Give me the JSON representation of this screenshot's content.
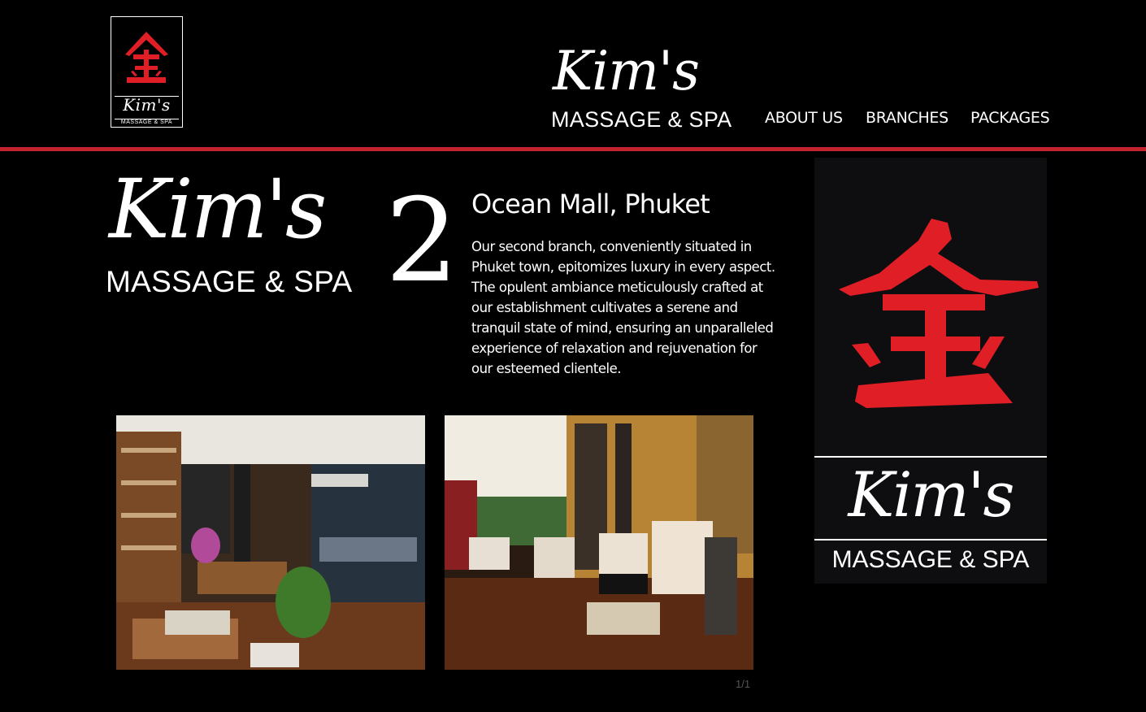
{
  "header": {
    "small_logo": {
      "brand": "Kim's",
      "subtitle": "MASSAGE & SPA",
      "glyph": "金"
    },
    "brand": {
      "name": "Kim's",
      "subtitle": "MASSAGE & SPA"
    },
    "nav": [
      {
        "label": "ABOUT US"
      },
      {
        "label": "BRANCHES"
      },
      {
        "label": "PACKAGES"
      }
    ]
  },
  "branch": {
    "logo": {
      "name": "Kim's",
      "subtitle": "MASSAGE & SPA",
      "number": "2"
    },
    "title": "Ocean Mall, Phuket",
    "description": "Our second branch, conveniently situated in Phuket town, epitomizes luxury in every aspect. The opulent ambiance meticulously crafted at our establishment cultivates a serene and tranquil state of mind, ensuring an unparalleled experience of relaxation and rejuvenation for our esteemed clientele."
  },
  "gallery": {
    "counter": "1/1"
  },
  "brand_panel": {
    "glyph": "金",
    "name": "Kim's",
    "subtitle": "MASSAGE & SPA"
  },
  "colors": {
    "accent_red": "#c3232c",
    "glyph_red": "#e01e26",
    "background": "#000000"
  }
}
